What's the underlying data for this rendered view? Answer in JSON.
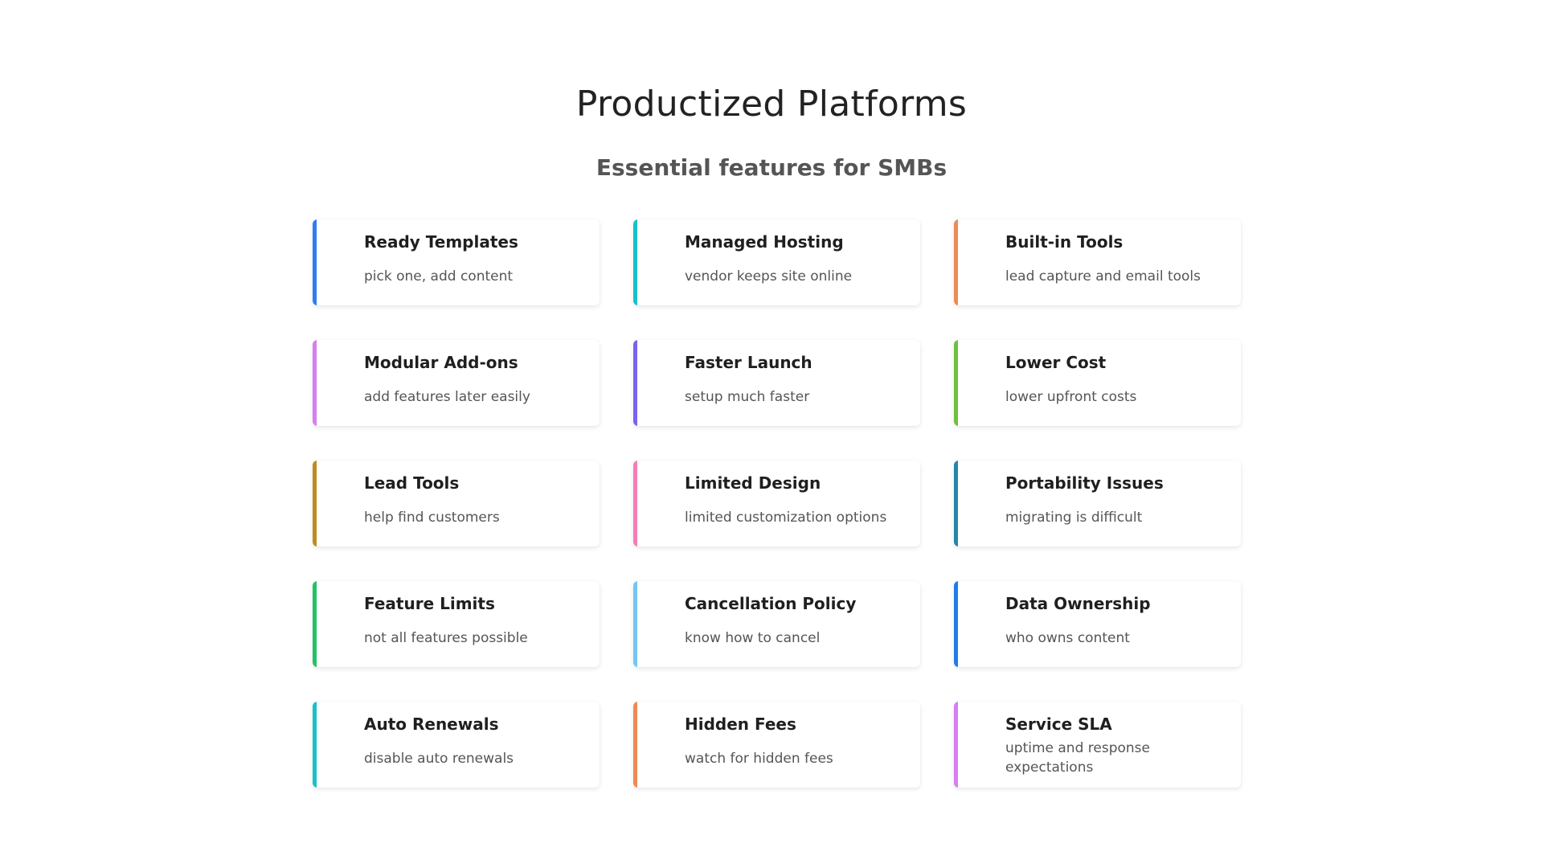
{
  "title": "Productized Platforms",
  "subtitle": "Essential features for SMBs",
  "cards": [
    {
      "title": "Ready Templates",
      "desc": "pick one, add content",
      "color": "#2f7cf6"
    },
    {
      "title": "Managed Hosting",
      "desc": "vendor keeps site online",
      "color": "#17c1c9"
    },
    {
      "title": "Built-in Tools",
      "desc": "lead capture and email tools",
      "color": "#ef8a55"
    },
    {
      "title": "Modular Add-ons",
      "desc": "add features later easily",
      "color": "#d67ef3"
    },
    {
      "title": "Faster Launch",
      "desc": "setup much faster",
      "color": "#7b61f0"
    },
    {
      "title": "Lower Cost",
      "desc": "lower upfront costs",
      "color": "#6cc13b"
    },
    {
      "title": "Lead Tools",
      "desc": "help find customers",
      "color": "#bf8c1c"
    },
    {
      "title": "Limited Design",
      "desc": "limited customization options",
      "color": "#f47db8"
    },
    {
      "title": "Portability Issues",
      "desc": "migrating is difficult",
      "color": "#2387a8"
    },
    {
      "title": "Feature Limits",
      "desc": "not all features possible",
      "color": "#20c366"
    },
    {
      "title": "Cancellation Policy",
      "desc": "know how to cancel",
      "color": "#74c6f1"
    },
    {
      "title": "Data Ownership",
      "desc": "who owns content",
      "color": "#1f7ce8"
    },
    {
      "title": "Auto Renewals",
      "desc": "disable auto renewals",
      "color": "#17c1c9"
    },
    {
      "title": "Hidden Fees",
      "desc": "watch for hidden fees",
      "color": "#ef8a55"
    },
    {
      "title": "Service SLA",
      "desc": "uptime and response expectations",
      "color": "#d67ef3"
    }
  ]
}
